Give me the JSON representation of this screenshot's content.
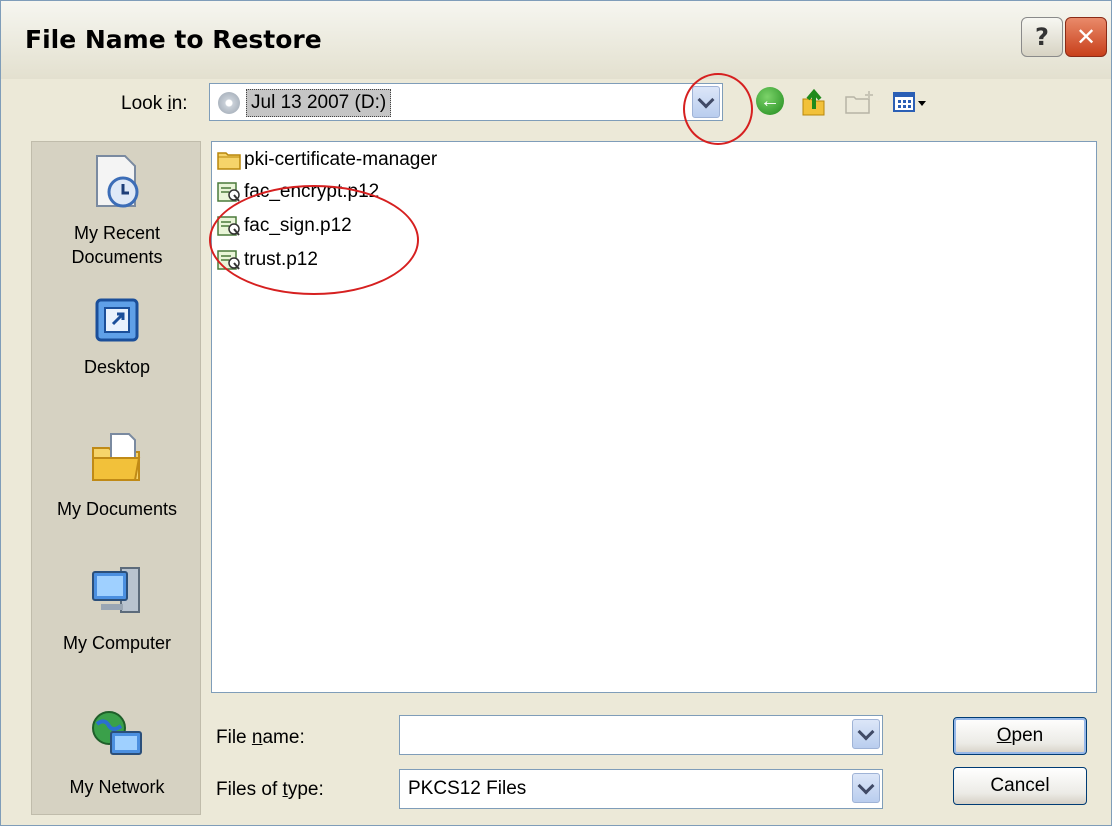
{
  "window": {
    "title": "File Name to Restore",
    "help_label": "?",
    "close_label": "✕"
  },
  "lookin": {
    "label_pre": "Look ",
    "label_mnemonic": "i",
    "label_post": "n:",
    "value": "Jul 13 2007 (D:)"
  },
  "toolbar": {
    "icons": [
      "back-icon",
      "up-folder-icon",
      "new-folder-icon",
      "views-menu-icon"
    ]
  },
  "places": [
    {
      "line1": "My Recent",
      "line2": "Documents",
      "icon": "recent-documents-icon"
    },
    {
      "line1": "Desktop",
      "line2": "",
      "icon": "desktop-icon"
    },
    {
      "line1": "My Documents",
      "line2": "",
      "icon": "my-documents-icon"
    },
    {
      "line1": "My Computer",
      "line2": "",
      "icon": "my-computer-icon"
    },
    {
      "line1": "My Network",
      "line2": "",
      "icon": "my-network-icon"
    }
  ],
  "files": [
    {
      "name": "pki-certificate-manager",
      "icon": "folder-icon"
    },
    {
      "name": "fac_encrypt.p12",
      "icon": "certificate-icon"
    },
    {
      "name": "fac_sign.p12",
      "icon": "certificate-icon"
    },
    {
      "name": "trust.p12",
      "icon": "certificate-icon"
    }
  ],
  "filename": {
    "label_pre": "File ",
    "label_mnemonic": "n",
    "label_post": "ame:",
    "value": ""
  },
  "filetype": {
    "label_pre": "Files of ",
    "label_mnemonic": "t",
    "label_post": "ype:",
    "value": "PKCS12 Files"
  },
  "buttons": {
    "open_mnemonic": "O",
    "open_rest": "pen",
    "cancel": "Cancel"
  },
  "colors": {
    "annotation": "#d62020",
    "title_bar": "#ece9d8",
    "close_button": "#c8401b"
  }
}
